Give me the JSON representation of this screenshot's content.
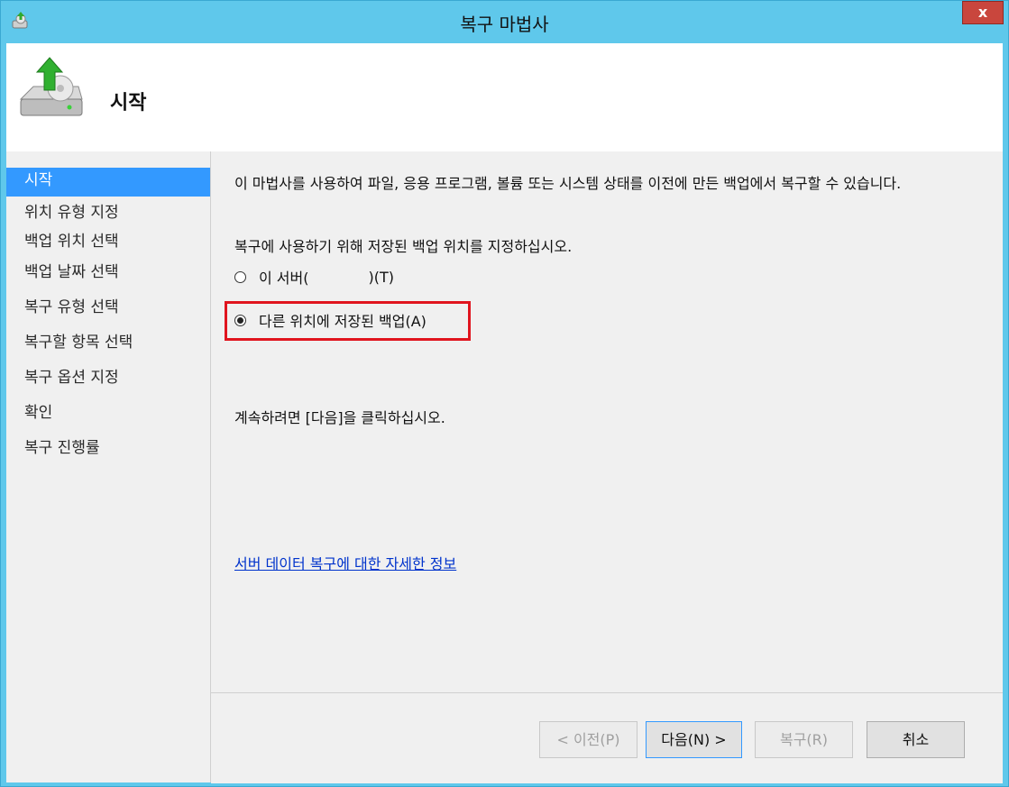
{
  "window": {
    "title": "복구 마법사",
    "close_label": "x"
  },
  "header": {
    "title": "시작"
  },
  "sidebar": {
    "items": [
      {
        "label": "시작",
        "active": true
      },
      {
        "label": "위치 유형 지정",
        "active": false
      },
      {
        "label": "백업 위치 선택",
        "active": false
      },
      {
        "label": "백업 날짜 선택",
        "active": false
      },
      {
        "label": "복구 유형 선택",
        "active": false
      },
      {
        "label": "복구할 항목 선택",
        "active": false
      },
      {
        "label": "복구 옵션 지정",
        "active": false
      },
      {
        "label": "확인",
        "active": false
      },
      {
        "label": "복구 진행률",
        "active": false
      }
    ]
  },
  "main": {
    "intro": "이 마법사를 사용하여 파일, 응용 프로그램, 볼륨 또는 시스템 상태를 이전에 만든 백업에서 복구할 수 있습니다.",
    "prompt": "복구에 사용하기 위해 저장된 백업 위치를 지정하십시오.",
    "options": [
      {
        "label_prefix": "이 서버(",
        "label_suffix": ")(T)",
        "selected": false
      },
      {
        "label": "다른 위치에 저장된 백업(A)",
        "selected": true
      }
    ],
    "continue_text": "계속하려면 [다음]을 클릭하십시오.",
    "link_text": "서버 데이터 복구에 대한 자세한 정보"
  },
  "buttons": {
    "back": "< 이전(P)",
    "next": "다음(N) >",
    "recover": "복구(R)",
    "cancel": "취소"
  },
  "colors": {
    "titlebar": "#5fc8eb",
    "sidebar_active": "#3399ff",
    "highlight": "#e0141e",
    "link": "#0033cc"
  }
}
